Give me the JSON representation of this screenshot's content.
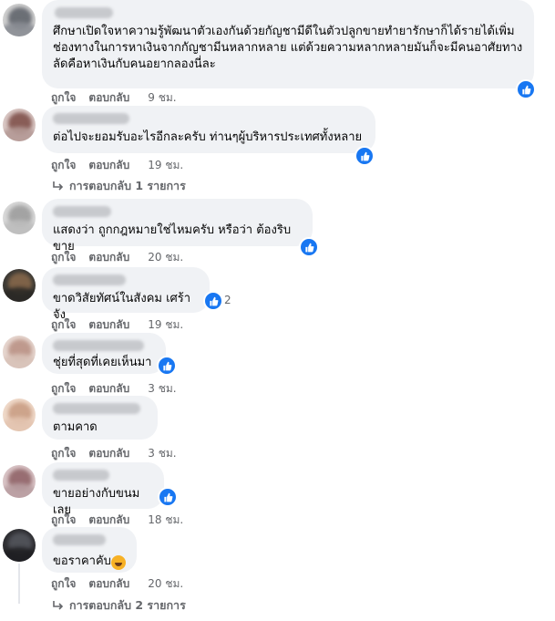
{
  "comments": [
    {
      "text": "ศึกษาเปิดใจหาความรู้พัฒนาตัวเองกันด้วยกัญชามีดีในตัวปลูกขายทำยารักษาก็ได้รายได้เพิ่ม\nช่องทางในการหาเงินจากกัญชามีนหลากหลาย แต่ด้วยความหลากหลายมันก็จะมีคนอาศัยทาง\nลัดคือหาเงินกับคนอยากลองนี่ละ",
      "like": "ถูกใจ",
      "reply": "ตอบกลับ",
      "time": "9 ชม.",
      "reaction": "like",
      "count": ""
    },
    {
      "text": "ต่อไปจะยอมรับอะไรอีกละครับ ท่านๆผู้บริหารประเทศทั้งหลาย",
      "like": "ถูกใจ",
      "reply": "ตอบกลับ",
      "time": "19 ชม.",
      "reaction": "like",
      "count": "",
      "replies": "การตอบกลับ 1 รายการ"
    },
    {
      "text": "แสดงว่า ถูกกฎหมายใช่ไหมครับ หรือว่า ต้องริบขาย",
      "like": "ถูกใจ",
      "reply": "ตอบกลับ",
      "time": "20 ชม.",
      "reaction": "like",
      "count": ""
    },
    {
      "text": "ขาดวิสัยทัศน์ในสังคม เศร้าจัง",
      "like": "ถูกใจ",
      "reply": "ตอบกลับ",
      "time": "19 ชม.",
      "reaction": "like",
      "count": "2"
    },
    {
      "text": "ชุ่ยที่สุดที่เคยเห็นมา",
      "like": "ถูกใจ",
      "reply": "ตอบกลับ",
      "time": "3 ชม.",
      "reaction": "like",
      "count": ""
    },
    {
      "text": "ตามคาด",
      "like": "ถูกใจ",
      "reply": "ตอบกลับ",
      "time": "3 ชม.",
      "reaction": "",
      "count": ""
    },
    {
      "text": "ขายอย่างกับขนมเลย",
      "like": "ถูกใจ",
      "reply": "ตอบกลับ",
      "time": "18 ชม.",
      "reaction": "like",
      "count": ""
    },
    {
      "text": "ขอราคาคับ...",
      "like": "ถูกใจ",
      "reply": "ตอบกลับ",
      "time": "20 ชม.",
      "reaction": "haha",
      "count": "",
      "replies": "การตอบกลับ 2 รายการ"
    }
  ],
  "colors": {
    "bubble": "#f0f2f5",
    "meta": "#65676b",
    "like_blue": "#1877f2",
    "haha": "#f7b125"
  },
  "icons": {
    "like": "thumbs-up-icon",
    "haha": "laughing-face-icon",
    "reply_arrow": "reply-arrow-icon"
  }
}
